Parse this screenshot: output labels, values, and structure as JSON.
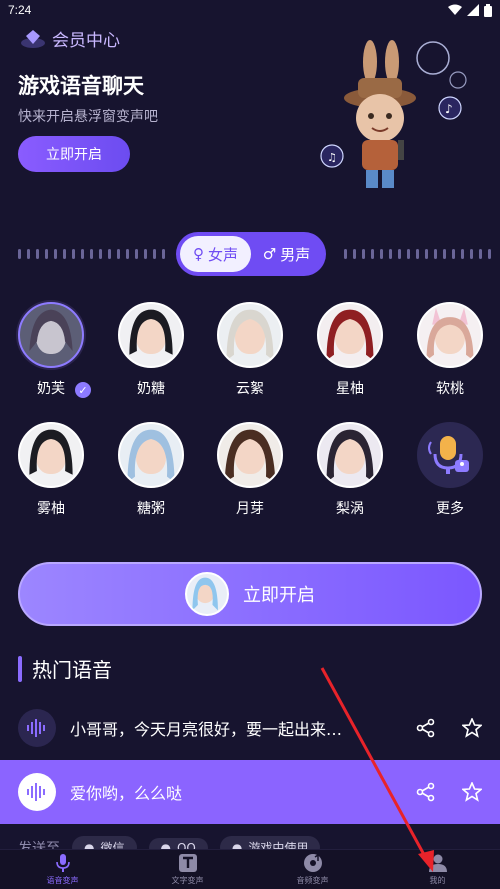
{
  "status": {
    "time": "7:24"
  },
  "header": {
    "member_center": "会员中心"
  },
  "hero": {
    "title": "游戏语音聊天",
    "subtitle": "快来开启悬浮窗变声吧",
    "button": "立即开启"
  },
  "gender": {
    "female": "女声",
    "male": "男声"
  },
  "voices": [
    {
      "name": "奶芙",
      "selected": true
    },
    {
      "name": "奶糖"
    },
    {
      "name": "云絮"
    },
    {
      "name": "星柚"
    },
    {
      "name": "软桃"
    },
    {
      "name": "雾柚"
    },
    {
      "name": "糖粥"
    },
    {
      "name": "月芽"
    },
    {
      "name": "梨涡"
    },
    {
      "name": "更多"
    }
  ],
  "start": {
    "label": "立即开启"
  },
  "hot": {
    "title": "热门语音",
    "items": [
      {
        "text": "小哥哥，今天月亮很好，要一起出来…"
      },
      {
        "text": "爱你哟，么么哒"
      }
    ]
  },
  "send": {
    "label": "发送至",
    "chips": [
      "微信",
      "QQ",
      "游戏中使用"
    ]
  },
  "nav": {
    "items": [
      "语音变声",
      "文字变声",
      "音频变声",
      "我的"
    ],
    "active": 0
  },
  "colors": {
    "accent": "#8b6cff",
    "background": "#17142f"
  }
}
